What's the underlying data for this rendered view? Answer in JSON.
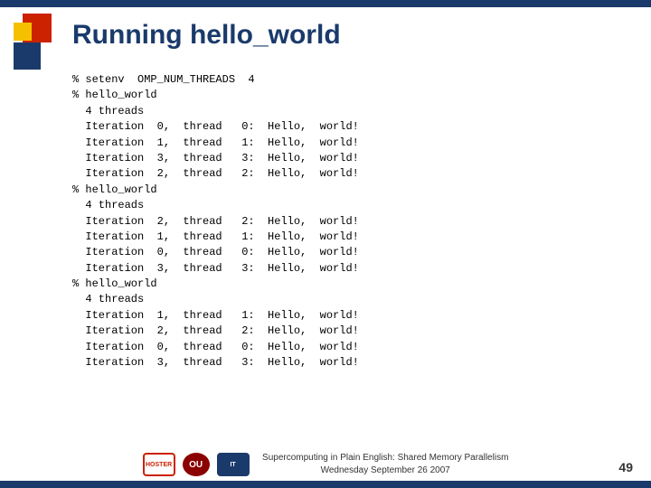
{
  "header": {
    "title": "Running hello_world"
  },
  "code": {
    "content": "% setenv  OMP_NUM_THREADS  4\n% hello_world\n  4 threads\n  Iteration  0,  thread   0:  Hello,  world!\n  Iteration  1,  thread   1:  Hello,  world!\n  Iteration  3,  thread   3:  Hello,  world!\n  Iteration  2,  thread   2:  Hello,  world!\n% hello_world\n  4 threads\n  Iteration  2,  thread   2:  Hello,  world!\n  Iteration  1,  thread   1:  Hello,  world!\n  Iteration  0,  thread   0:  Hello,  world!\n  Iteration  3,  thread   3:  Hello,  world!\n% hello_world\n  4 threads\n  Iteration  1,  thread   1:  Hello,  world!\n  Iteration  2,  thread   2:  Hello,  world!\n  Iteration  0,  thread   0:  Hello,  world!\n  Iteration  3,  thread   3:  Hello,  world!"
  },
  "footer": {
    "line1": "Supercomputing in Plain English: Shared Memory Parallelism",
    "line2": "Wednesday September 26 2007",
    "page": "49",
    "logos": {
      "hoster": "HOSTER",
      "ou": "OU",
      "it": "IT"
    }
  }
}
